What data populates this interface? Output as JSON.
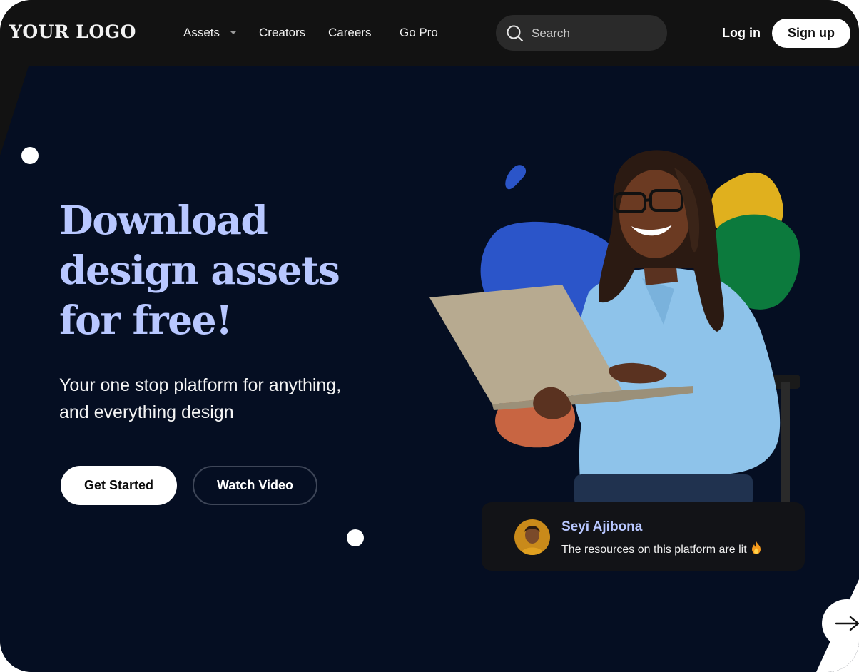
{
  "header": {
    "logo": "YOUR LOGO",
    "nav": [
      {
        "label": "Assets",
        "has_dropdown": true
      },
      {
        "label": "Creators"
      },
      {
        "label": "Careers"
      },
      {
        "label": "Go Pro"
      }
    ],
    "search": {
      "placeholder": "Search",
      "icon": "search-icon"
    },
    "login_label": "Log in",
    "signup_label": "Sign up"
  },
  "hero": {
    "headline_lines": [
      "Download",
      "design assets",
      "for free!"
    ],
    "subtitle_lines": [
      "Your one stop platform for anything,",
      "and everything design"
    ],
    "primary_cta": "Get Started",
    "secondary_cta": "Watch Video"
  },
  "testimonial": {
    "name": "Seyi Ajibona",
    "quote": "The resources on this platform are lit",
    "emoji_icon": "fire-icon"
  },
  "next_button_icon": "arrow-right-icon",
  "colors": {
    "background": "#050e22",
    "header": "#121212",
    "accent": "#b8c7ff",
    "blob_blue": "#2b55c9",
    "blob_yellow": "#e0b01e",
    "blob_green": "#0c7a3d",
    "blob_orange": "#c86542"
  }
}
